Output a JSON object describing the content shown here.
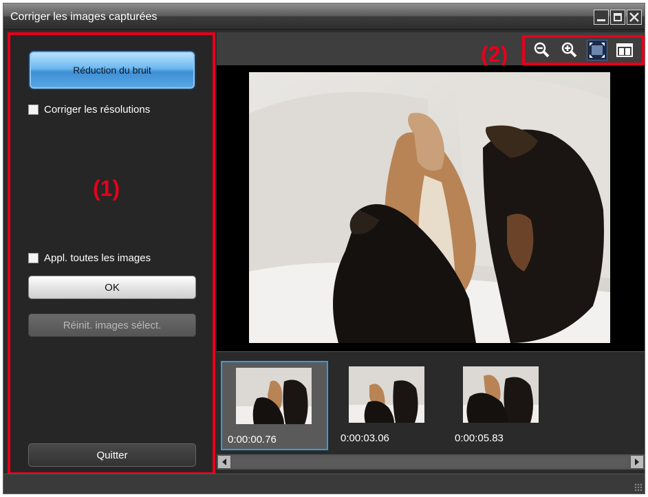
{
  "window": {
    "title": "Corriger les images capturées"
  },
  "left_panel": {
    "noise_reduction_label": "Réduction du bruit",
    "correct_resolutions_label": "Corriger les résolutions",
    "callout_1": "(1)",
    "apply_all_label": "Appl. toutes les images",
    "ok_label": "OK",
    "reset_label": "Réinit. images sélect.",
    "quit_label": "Quitter"
  },
  "toolbar": {
    "callout_2": "(2)",
    "buttons": [
      "zoom-out-icon",
      "zoom-in-icon",
      "fit-view-icon",
      "side-by-side-icon"
    ]
  },
  "thumbnails": [
    {
      "time": "0:00:00.76",
      "selected": true
    },
    {
      "time": "0:00:03.06",
      "selected": false
    },
    {
      "time": "0:00:05.83",
      "selected": false
    }
  ],
  "colors": {
    "callout": "#e6001a",
    "accent": "#2aa0e8"
  }
}
